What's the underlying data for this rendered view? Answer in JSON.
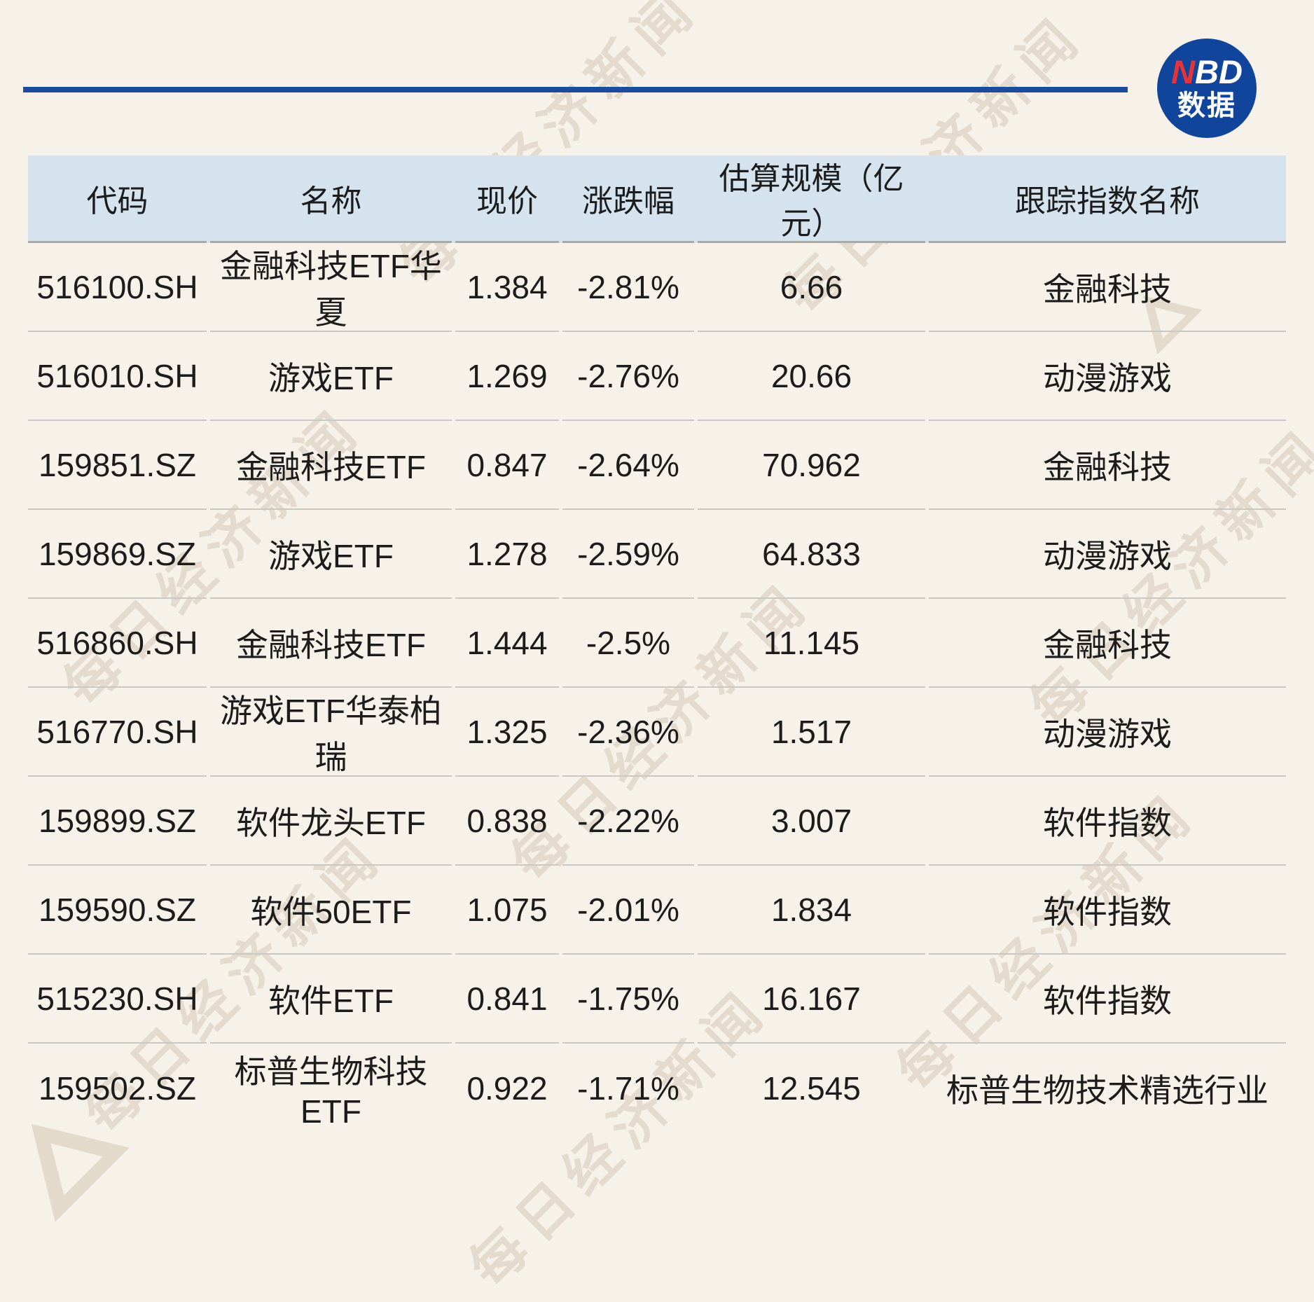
{
  "brand": {
    "logo_part_accent": "N",
    "logo_part_rest": "BD",
    "logo_line2": "数据",
    "logo_bg": "#10459B",
    "accent_red": "#E63438",
    "divider_blue": "#1A4B9D"
  },
  "watermark": {
    "text": "每日经济新闻"
  },
  "table": {
    "header_bg": "#D5E3EF",
    "columns": [
      "代码",
      "名称",
      "现价",
      "涨跌幅",
      "估算规模（亿元）",
      "跟踪指数名称"
    ],
    "rows": [
      {
        "code": "516100.SH",
        "name": "金融科技ETF华夏",
        "price": "1.384",
        "change": "-2.81%",
        "scale": "6.66",
        "index": "金融科技"
      },
      {
        "code": "516010.SH",
        "name": "游戏ETF",
        "price": "1.269",
        "change": "-2.76%",
        "scale": "20.66",
        "index": "动漫游戏"
      },
      {
        "code": "159851.SZ",
        "name": "金融科技ETF",
        "price": "0.847",
        "change": "-2.64%",
        "scale": "70.962",
        "index": "金融科技"
      },
      {
        "code": "159869.SZ",
        "name": "游戏ETF",
        "price": "1.278",
        "change": "-2.59%",
        "scale": "64.833",
        "index": "动漫游戏"
      },
      {
        "code": "516860.SH",
        "name": "金融科技ETF",
        "price": "1.444",
        "change": "-2.5%",
        "scale": "11.145",
        "index": "金融科技"
      },
      {
        "code": "516770.SH",
        "name": "游戏ETF华泰柏瑞",
        "price": "1.325",
        "change": "-2.36%",
        "scale": "1.517",
        "index": "动漫游戏"
      },
      {
        "code": "159899.SZ",
        "name": "软件龙头ETF",
        "price": "0.838",
        "change": "-2.22%",
        "scale": "3.007",
        "index": "软件指数"
      },
      {
        "code": "159590.SZ",
        "name": "软件50ETF",
        "price": "1.075",
        "change": "-2.01%",
        "scale": "1.834",
        "index": "软件指数"
      },
      {
        "code": "515230.SH",
        "name": "软件ETF",
        "price": "0.841",
        "change": "-1.75%",
        "scale": "16.167",
        "index": "软件指数"
      },
      {
        "code": "159502.SZ",
        "name": "标普生物科技ETF",
        "price": "0.922",
        "change": "-1.71%",
        "scale": "12.545",
        "index": "标普生物技术精选行业"
      }
    ]
  },
  "chart_data": {
    "type": "table",
    "title": "",
    "columns": [
      "代码",
      "名称",
      "现价",
      "涨跌幅",
      "估算规模（亿元）",
      "跟踪指数名称"
    ],
    "rows": [
      [
        "516100.SH",
        "金融科技ETF华夏",
        1.384,
        "-2.81%",
        6.66,
        "金融科技"
      ],
      [
        "516010.SH",
        "游戏ETF",
        1.269,
        "-2.76%",
        20.66,
        "动漫游戏"
      ],
      [
        "159851.SZ",
        "金融科技ETF",
        0.847,
        "-2.64%",
        70.962,
        "金融科技"
      ],
      [
        "159869.SZ",
        "游戏ETF",
        1.278,
        "-2.59%",
        64.833,
        "动漫游戏"
      ],
      [
        "516860.SH",
        "金融科技ETF",
        1.444,
        "-2.5%",
        11.145,
        "金融科技"
      ],
      [
        "516770.SH",
        "游戏ETF华泰柏瑞",
        1.325,
        "-2.36%",
        1.517,
        "动漫游戏"
      ],
      [
        "159899.SZ",
        "软件龙头ETF",
        0.838,
        "-2.22%",
        3.007,
        "软件指数"
      ],
      [
        "159590.SZ",
        "软件50ETF",
        1.075,
        "-2.01%",
        1.834,
        "软件指数"
      ],
      [
        "515230.SH",
        "软件ETF",
        0.841,
        "-1.75%",
        16.167,
        "软件指数"
      ],
      [
        "159502.SZ",
        "标普生物科技ETF",
        0.922,
        "-1.71%",
        12.545,
        "标普生物技术精选行业"
      ]
    ]
  }
}
